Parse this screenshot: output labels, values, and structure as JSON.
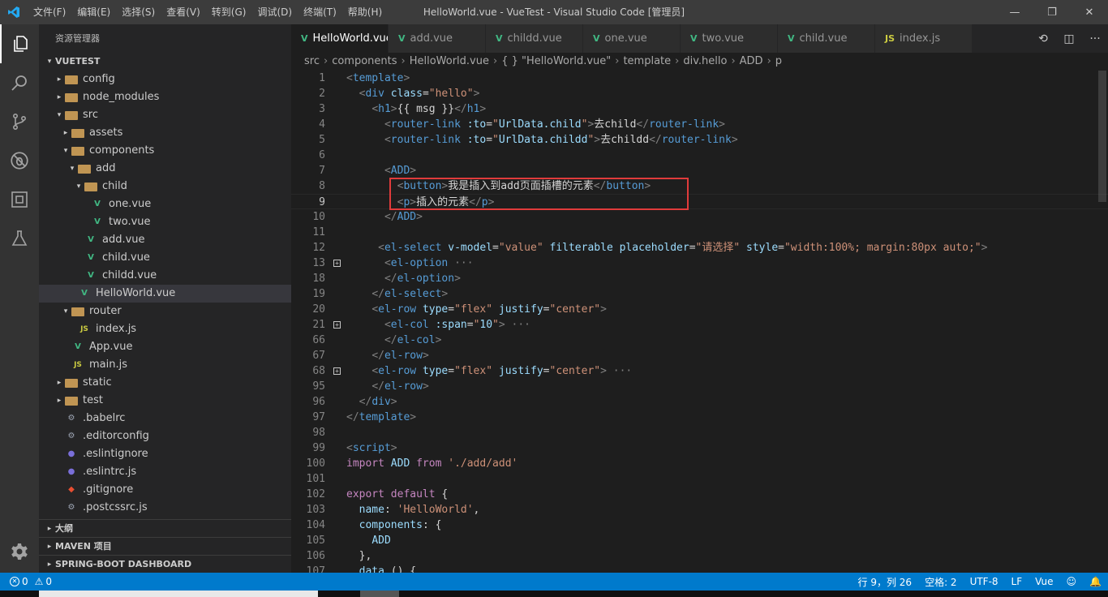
{
  "titlebar": {
    "menu": [
      "文件(F)",
      "编辑(E)",
      "选择(S)",
      "查看(V)",
      "转到(G)",
      "调试(D)",
      "终端(T)",
      "帮助(H)"
    ],
    "title": "HelloWorld.vue - VueTest - Visual Studio Code [管理员]",
    "minimize_glyph": "—",
    "maximize_glyph": "❐",
    "close_glyph": "✕"
  },
  "activity_bar": {
    "items": [
      "files-icon",
      "search-icon",
      "source-control-icon",
      "debug-icon",
      "extensions-icon",
      "test-icon"
    ],
    "bottom": "gear-icon"
  },
  "sidebar": {
    "title": "资源管理器",
    "project": "VUETEST",
    "tree": [
      {
        "label": "config",
        "indent": 1,
        "twisty": "closed",
        "icon": "folder"
      },
      {
        "label": "node_modules",
        "indent": 1,
        "twisty": "closed",
        "icon": "folder"
      },
      {
        "label": "src",
        "indent": 1,
        "twisty": "open",
        "icon": "folder"
      },
      {
        "label": "assets",
        "indent": 2,
        "twisty": "closed",
        "icon": "folder"
      },
      {
        "label": "components",
        "indent": 2,
        "twisty": "open",
        "icon": "folder"
      },
      {
        "label": "add",
        "indent": 3,
        "twisty": "open",
        "icon": "folder"
      },
      {
        "label": "child",
        "indent": 4,
        "twisty": "open",
        "icon": "folder"
      },
      {
        "label": "one.vue",
        "indent": 5,
        "twisty": "",
        "icon": "vue"
      },
      {
        "label": "two.vue",
        "indent": 5,
        "twisty": "",
        "icon": "vue"
      },
      {
        "label": "add.vue",
        "indent": 4,
        "twisty": "",
        "icon": "vue"
      },
      {
        "label": "child.vue",
        "indent": 4,
        "twisty": "",
        "icon": "vue"
      },
      {
        "label": "childd.vue",
        "indent": 4,
        "twisty": "",
        "icon": "vue"
      },
      {
        "label": "HelloWorld.vue",
        "indent": 3,
        "twisty": "",
        "icon": "vue",
        "selected": true
      },
      {
        "label": "router",
        "indent": 2,
        "twisty": "open",
        "icon": "folder"
      },
      {
        "label": "index.js",
        "indent": 3,
        "twisty": "",
        "icon": "js"
      },
      {
        "label": "App.vue",
        "indent": 2,
        "twisty": "",
        "icon": "vue"
      },
      {
        "label": "main.js",
        "indent": 2,
        "twisty": "",
        "icon": "js"
      },
      {
        "label": "static",
        "indent": 1,
        "twisty": "closed",
        "icon": "folder"
      },
      {
        "label": "test",
        "indent": 1,
        "twisty": "closed",
        "icon": "folder"
      },
      {
        "label": ".babelrc",
        "indent": 1,
        "twisty": "",
        "icon": "gen"
      },
      {
        "label": ".editorconfig",
        "indent": 1,
        "twisty": "",
        "icon": "gen"
      },
      {
        "label": ".eslintignore",
        "indent": 1,
        "twisty": "",
        "icon": "dot"
      },
      {
        "label": ".eslintrc.js",
        "indent": 1,
        "twisty": "",
        "icon": "dot"
      },
      {
        "label": ".gitignore",
        "indent": 1,
        "twisty": "",
        "icon": "git"
      },
      {
        "label": ".postcssrc.js",
        "indent": 1,
        "twisty": "",
        "icon": "gen"
      }
    ],
    "sections": [
      "大纲",
      "MAVEN 项目",
      "SPRING-BOOT DASHBOARD"
    ]
  },
  "tabs": [
    {
      "label": "HelloWorld.vue",
      "icon": "vue",
      "active": true
    },
    {
      "label": "add.vue",
      "icon": "vue"
    },
    {
      "label": "childd.vue",
      "icon": "vue"
    },
    {
      "label": "one.vue",
      "icon": "vue"
    },
    {
      "label": "two.vue",
      "icon": "vue"
    },
    {
      "label": "child.vue",
      "icon": "vue"
    },
    {
      "label": "index.js",
      "icon": "js"
    }
  ],
  "breadcrumb": [
    "src",
    "components",
    "HelloWorld.vue",
    "{ } \"HelloWorld.vue\"",
    "template",
    "div.hello",
    "ADD",
    "p"
  ],
  "editor": {
    "current_line": 9,
    "lines": [
      {
        "n": "1",
        "parts": [
          [
            "br",
            "<"
          ],
          [
            "tag",
            "template"
          ],
          [
            "br",
            ">"
          ]
        ]
      },
      {
        "n": "2",
        "parts": [
          [
            "txt",
            "  "
          ],
          [
            "br",
            "<"
          ],
          [
            "tag",
            "div"
          ],
          [
            "txt",
            " "
          ],
          [
            "attr",
            "class"
          ],
          [
            "txt",
            "="
          ],
          [
            "str",
            "\"hello\""
          ],
          [
            "br",
            ">"
          ]
        ]
      },
      {
        "n": "3",
        "parts": [
          [
            "txt",
            "    "
          ],
          [
            "br",
            "<"
          ],
          [
            "tag",
            "h1"
          ],
          [
            "br",
            ">"
          ],
          [
            "txt",
            "{{ msg }}"
          ],
          [
            "br",
            "</"
          ],
          [
            "tag",
            "h1"
          ],
          [
            "br",
            ">"
          ]
        ]
      },
      {
        "n": "4",
        "parts": [
          [
            "txt",
            "      "
          ],
          [
            "br",
            "<"
          ],
          [
            "tag",
            "router-link"
          ],
          [
            "txt",
            " "
          ],
          [
            "attr",
            ":to"
          ],
          [
            "txt",
            "="
          ],
          [
            "str",
            "\""
          ],
          [
            "var",
            "UrlData.child"
          ],
          [
            "str",
            "\""
          ],
          [
            "br",
            ">"
          ],
          [
            "txt",
            "去child"
          ],
          [
            "br",
            "</"
          ],
          [
            "tag",
            "router-link"
          ],
          [
            "br",
            ">"
          ]
        ]
      },
      {
        "n": "5",
        "parts": [
          [
            "txt",
            "      "
          ],
          [
            "br",
            "<"
          ],
          [
            "tag",
            "router-link"
          ],
          [
            "txt",
            " "
          ],
          [
            "attr",
            ":to"
          ],
          [
            "txt",
            "="
          ],
          [
            "str",
            "\""
          ],
          [
            "var",
            "UrlData.childd"
          ],
          [
            "str",
            "\""
          ],
          [
            "br",
            ">"
          ],
          [
            "txt",
            "去childd"
          ],
          [
            "br",
            "</"
          ],
          [
            "tag",
            "router-link"
          ],
          [
            "br",
            ">"
          ]
        ]
      },
      {
        "n": "6",
        "parts": []
      },
      {
        "n": "7",
        "parts": [
          [
            "txt",
            "      "
          ],
          [
            "br",
            "<"
          ],
          [
            "tag",
            "ADD"
          ],
          [
            "br",
            ">"
          ]
        ]
      },
      {
        "n": "8",
        "parts": [
          [
            "txt",
            "        "
          ],
          [
            "br",
            "<"
          ],
          [
            "tag",
            "button"
          ],
          [
            "br",
            ">"
          ],
          [
            "txt",
            "我是插入到add页面插槽的元素"
          ],
          [
            "br",
            "</"
          ],
          [
            "tag",
            "button"
          ],
          [
            "br",
            ">"
          ]
        ]
      },
      {
        "n": "9",
        "parts": [
          [
            "txt",
            "        "
          ],
          [
            "br",
            "<"
          ],
          [
            "tag",
            "p"
          ],
          [
            "br",
            ">"
          ],
          [
            "txt",
            "插入的元素"
          ],
          [
            "br",
            "</"
          ],
          [
            "tag",
            "p"
          ],
          [
            "br",
            ">"
          ]
        ]
      },
      {
        "n": "10",
        "parts": [
          [
            "txt",
            "      "
          ],
          [
            "br",
            "</"
          ],
          [
            "tag",
            "ADD"
          ],
          [
            "br",
            ">"
          ]
        ]
      },
      {
        "n": "11",
        "parts": []
      },
      {
        "n": "12",
        "parts": [
          [
            "txt",
            "     "
          ],
          [
            "br",
            "<"
          ],
          [
            "tag",
            "el-select"
          ],
          [
            "txt",
            " "
          ],
          [
            "attr",
            "v-model"
          ],
          [
            "txt",
            "="
          ],
          [
            "str",
            "\"value\""
          ],
          [
            "txt",
            " "
          ],
          [
            "attr",
            "filterable"
          ],
          [
            "txt",
            " "
          ],
          [
            "attr",
            "placeholder"
          ],
          [
            "txt",
            "="
          ],
          [
            "str",
            "\"请选择\""
          ],
          [
            "txt",
            " "
          ],
          [
            "attr",
            "style"
          ],
          [
            "txt",
            "="
          ],
          [
            "str",
            "\"width:100%; margin:80px auto;\""
          ],
          [
            "br",
            ">"
          ]
        ]
      },
      {
        "n": "13",
        "fold": true,
        "parts": [
          [
            "txt",
            "      "
          ],
          [
            "br",
            "<"
          ],
          [
            "tag",
            "el-option"
          ],
          [
            "fold",
            " ···"
          ]
        ]
      },
      {
        "n": "18",
        "parts": [
          [
            "txt",
            "      "
          ],
          [
            "br",
            "</"
          ],
          [
            "tag",
            "el-option"
          ],
          [
            "br",
            ">"
          ]
        ]
      },
      {
        "n": "19",
        "parts": [
          [
            "txt",
            "    "
          ],
          [
            "br",
            "</"
          ],
          [
            "tag",
            "el-select"
          ],
          [
            "br",
            ">"
          ]
        ]
      },
      {
        "n": "20",
        "parts": [
          [
            "txt",
            "    "
          ],
          [
            "br",
            "<"
          ],
          [
            "tag",
            "el-row"
          ],
          [
            "txt",
            " "
          ],
          [
            "attr",
            "type"
          ],
          [
            "txt",
            "="
          ],
          [
            "str",
            "\"flex\""
          ],
          [
            "txt",
            " "
          ],
          [
            "attr",
            "justify"
          ],
          [
            "txt",
            "="
          ],
          [
            "str",
            "\"center\""
          ],
          [
            "br",
            ">"
          ]
        ]
      },
      {
        "n": "21",
        "fold": true,
        "parts": [
          [
            "txt",
            "      "
          ],
          [
            "br",
            "<"
          ],
          [
            "tag",
            "el-col"
          ],
          [
            "txt",
            " "
          ],
          [
            "attr",
            ":span"
          ],
          [
            "txt",
            "="
          ],
          [
            "str",
            "\""
          ],
          [
            "var",
            "10"
          ],
          [
            "str",
            "\""
          ],
          [
            "br",
            ">"
          ],
          [
            "fold",
            " ···"
          ]
        ]
      },
      {
        "n": "66",
        "parts": [
          [
            "txt",
            "      "
          ],
          [
            "br",
            "</"
          ],
          [
            "tag",
            "el-col"
          ],
          [
            "br",
            ">"
          ]
        ]
      },
      {
        "n": "67",
        "parts": [
          [
            "txt",
            "    "
          ],
          [
            "br",
            "</"
          ],
          [
            "tag",
            "el-row"
          ],
          [
            "br",
            ">"
          ]
        ]
      },
      {
        "n": "68",
        "fold": true,
        "parts": [
          [
            "txt",
            "    "
          ],
          [
            "br",
            "<"
          ],
          [
            "tag",
            "el-row"
          ],
          [
            "txt",
            " "
          ],
          [
            "attr",
            "type"
          ],
          [
            "txt",
            "="
          ],
          [
            "str",
            "\"flex\""
          ],
          [
            "txt",
            " "
          ],
          [
            "attr",
            "justify"
          ],
          [
            "txt",
            "="
          ],
          [
            "str",
            "\"center\""
          ],
          [
            "br",
            ">"
          ],
          [
            "fold",
            " ···"
          ]
        ]
      },
      {
        "n": "95",
        "parts": [
          [
            "txt",
            "    "
          ],
          [
            "br",
            "</"
          ],
          [
            "tag",
            "el-row"
          ],
          [
            "br",
            ">"
          ]
        ]
      },
      {
        "n": "96",
        "parts": [
          [
            "txt",
            "  "
          ],
          [
            "br",
            "</"
          ],
          [
            "tag",
            "div"
          ],
          [
            "br",
            ">"
          ]
        ]
      },
      {
        "n": "97",
        "parts": [
          [
            "br",
            "</"
          ],
          [
            "tag",
            "template"
          ],
          [
            "br",
            ">"
          ]
        ]
      },
      {
        "n": "98",
        "parts": []
      },
      {
        "n": "99",
        "parts": [
          [
            "br",
            "<"
          ],
          [
            "tag",
            "script"
          ],
          [
            "br",
            ">"
          ]
        ]
      },
      {
        "n": "100",
        "parts": [
          [
            "kw",
            "import"
          ],
          [
            "txt",
            " "
          ],
          [
            "var",
            "ADD"
          ],
          [
            "txt",
            " "
          ],
          [
            "kw",
            "from"
          ],
          [
            "txt",
            " "
          ],
          [
            "str",
            "'./add/add'"
          ]
        ]
      },
      {
        "n": "101",
        "parts": []
      },
      {
        "n": "102",
        "parts": [
          [
            "kw",
            "export"
          ],
          [
            "txt",
            " "
          ],
          [
            "kw",
            "default"
          ],
          [
            "txt",
            " {"
          ]
        ]
      },
      {
        "n": "103",
        "parts": [
          [
            "txt",
            "  "
          ],
          [
            "var",
            "name"
          ],
          [
            "txt",
            ": "
          ],
          [
            "str",
            "'HelloWorld'"
          ],
          [
            "txt",
            ","
          ]
        ]
      },
      {
        "n": "104",
        "parts": [
          [
            "txt",
            "  "
          ],
          [
            "var",
            "components"
          ],
          [
            "txt",
            ": {"
          ]
        ]
      },
      {
        "n": "105",
        "parts": [
          [
            "txt",
            "    "
          ],
          [
            "var",
            "ADD"
          ]
        ]
      },
      {
        "n": "106",
        "parts": [
          [
            "txt",
            "  },"
          ]
        ]
      },
      {
        "n": "107",
        "parts": [
          [
            "txt",
            "  "
          ],
          [
            "var",
            "data"
          ],
          [
            "txt",
            " () {"
          ]
        ]
      }
    ]
  },
  "statusbar": {
    "errors": "0",
    "warnings": "0",
    "position": "行 9，列 26",
    "spaces": "空格: 2",
    "encoding": "UTF-8",
    "eol": "LF",
    "language": "Vue"
  }
}
